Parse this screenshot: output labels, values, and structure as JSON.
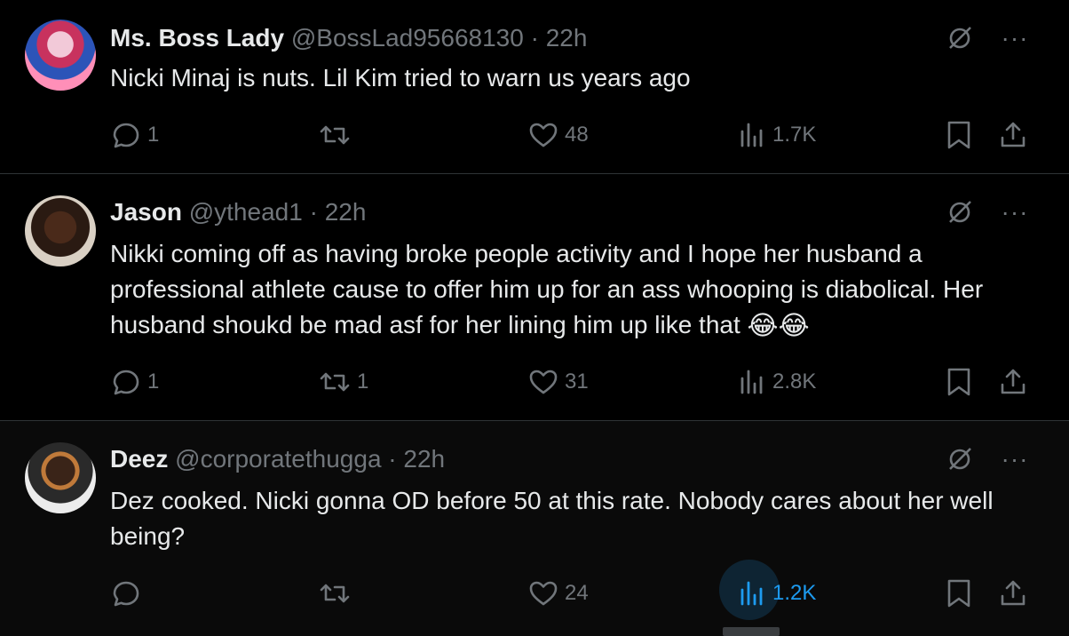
{
  "tweets": [
    {
      "name": "Ms. Boss Lady",
      "handle": "@BossLad95668130",
      "dot": "·",
      "time": "22h",
      "text": "Nicki Minaj is nuts. Lil Kim tried to warn us years ago",
      "emoji": "",
      "replies": "1",
      "retweets": "",
      "likes": "48",
      "views": "1.7K"
    },
    {
      "name": "Jason",
      "handle": "@ythead1",
      "dot": "·",
      "time": "22h",
      "text": "Nikki coming off as having broke people activity and I hope her husband a professional athlete cause to offer him up for an ass whooping is diabolical. Her husband shoukd be mad asf for her lining him up like that",
      "emoji": "😂😂",
      "replies": "1",
      "retweets": "1",
      "likes": "31",
      "views": "2.8K"
    },
    {
      "name": "Deez",
      "handle": "@corporatethugga",
      "dot": "·",
      "time": "22h",
      "text": "Dez cooked. Nicki gonna OD before 50 at this rate. Nobody cares about her well being?",
      "emoji": "",
      "replies": "",
      "retweets": "",
      "likes": "24",
      "views": "1.2K"
    }
  ],
  "more_glyph": "···",
  "colors": {
    "background": "#000000",
    "text": "#e7e9ea",
    "muted": "#71767b",
    "accent": "#1d9bf0",
    "divider": "#2f3336"
  },
  "icons": [
    "reply-icon",
    "retweet-icon",
    "like-icon",
    "views-icon",
    "bookmark-icon",
    "share-icon",
    "grok-icon",
    "more-icon"
  ]
}
